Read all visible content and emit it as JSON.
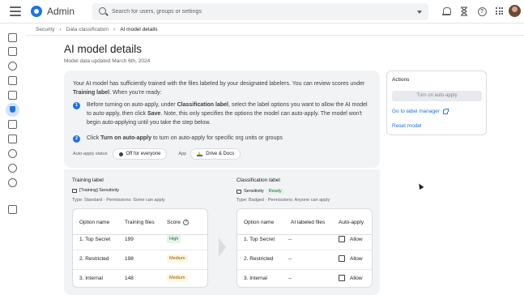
{
  "header": {
    "app_title": "Admin",
    "search_placeholder": "Search for users, groups or settings",
    "help_glyph": "?"
  },
  "breadcrumb": [
    "Security",
    "Data classification",
    "AI model details"
  ],
  "page": {
    "title": "AI model details",
    "subtitle": "Model data updated March 6th, 2024"
  },
  "info": {
    "intro_pre": "Your AI model has sufficiently trained with the files labeled by your designated labelers. You can review scores under ",
    "intro_bold": "Training label",
    "intro_post": ". When you're ready:",
    "steps": [
      {
        "num": "1",
        "pre": "Before turning on auto-apply, under ",
        "bold1": "Classification label",
        "mid": ", select the label options you want to allow the AI model to auto-apply, then click ",
        "bold2": "Save",
        "post": ". Note, this only specifies the options the model can auto-apply. The model won't begin auto-applying until you take the step below."
      },
      {
        "num": "2",
        "pre": "Click ",
        "bold1": "Turn on auto-apply",
        "post": " to turn on auto-apply for specific org units or groups"
      }
    ],
    "status_label": "Auto-apply status",
    "status_value": "Off for everyone",
    "app_label": "App",
    "app_value": "Drive & Docs"
  },
  "actions": {
    "title": "Actions",
    "turn_on_button": "Turn on auto-apply",
    "label_manager_link": "Go to label manager",
    "reset_link": "Reset model"
  },
  "training": {
    "title": "Training label",
    "label_name": "[Training] Sensitivity",
    "type_line": "Type: Standard · Permissions: Some can apply",
    "columns": [
      "Option name",
      "Training files",
      "Score"
    ],
    "rows": [
      {
        "option": "1. Top Secret",
        "files": "199",
        "score": "High",
        "score_color": "#137333"
      },
      {
        "option": "2. Restricted",
        "files": "198",
        "score": "Medium",
        "score_color": "#8a5a00"
      },
      {
        "option": "3. Internal",
        "files": "148",
        "score": "Medium",
        "score_color": "#8a5a00"
      }
    ]
  },
  "classification": {
    "title": "Classification label",
    "label_name": "Sensitivity",
    "status_badge": "Ready",
    "type_line": "Type: Badged · Permissions: Anyone can apply",
    "columns": [
      "Option name",
      "AI labeled files",
      "Auto-apply"
    ],
    "rows": [
      {
        "option": "1. Top Secret",
        "files": "--",
        "allow": "Allow",
        "checked": false
      },
      {
        "option": "2. Restricted",
        "files": "--",
        "allow": "Allow",
        "checked": false
      },
      {
        "option": "3. Internal",
        "files": "--",
        "allow": "Allow",
        "checked": false
      }
    ]
  },
  "colors": {
    "accent": "#1a73e8",
    "panel_bg": "#f1f3f4",
    "high_bg": "#e6f4ea",
    "medium_bg": "#fef7e0"
  }
}
